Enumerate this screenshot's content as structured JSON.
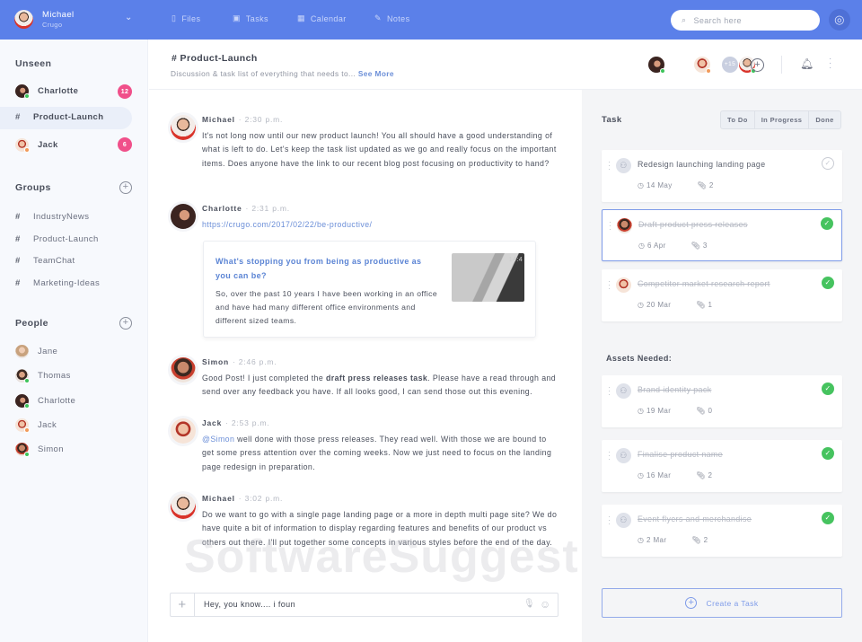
{
  "user": {
    "name": "Michael",
    "org": "Crugo"
  },
  "nav": [
    {
      "label": "Files",
      "icon": "file-icon"
    },
    {
      "label": "Tasks",
      "icon": "tasks-icon"
    },
    {
      "label": "Calendar",
      "icon": "calendar-icon"
    },
    {
      "label": "Notes",
      "icon": "notes-icon"
    }
  ],
  "search": {
    "placeholder": "Search here"
  },
  "sidebar": {
    "unseen_title": "Unseen",
    "unseen": [
      {
        "label": "Charlotte",
        "badge": "12"
      },
      {
        "label": "Product-Launch"
      },
      {
        "label": "Jack",
        "badge": "6"
      }
    ],
    "groups_title": "Groups",
    "groups": [
      "IndustryNews",
      "Product-Launch",
      "TeamChat",
      "Marketing-Ideas"
    ],
    "people_title": "People",
    "people": [
      "Jane",
      "Thomas",
      "Charlotte",
      "Jack",
      "Simon"
    ]
  },
  "channel": {
    "title": "# Product-Launch",
    "desc": "Discussion & task list of everything that needs to...",
    "see_more": "See More",
    "member_extra": "+15"
  },
  "messages": [
    {
      "author": "Michael",
      "time": "2:30 p.m.",
      "text": "It's not long now until our new product launch! You all should have a good understanding of what is left to do. Let's keep the task list updated as we go and really focus on the important items. Does anyone have the link to our recent blog post focusing on productivity to hand?"
    },
    {
      "author": "Charlotte",
      "time": "2:31 p.m.",
      "link": "https://crugo.com/2017/02/22/be-productive/",
      "preview_title": "What's stopping you from being as productive as you can be?",
      "preview_text": "So, over the past 10 years I have been working in an office and have had many different office environments and different sized teams.",
      "preview_img_text": "14:4"
    },
    {
      "author": "Simon",
      "time": "2:46 p.m.",
      "pre": "Good Post! I just completed the ",
      "bold": "draft press releases task",
      "post": ". Please have a read through and send over any feedback you have. If all looks good, I can send those out this evening."
    },
    {
      "author": "Jack",
      "time": "2:53 p.m.",
      "mention": "@Simon",
      "text": " well done with those press releases. They read well. With those we are bound to get some press attention over the coming weeks. Now we just need to focus on the landing page redesign in preparation."
    },
    {
      "author": "Michael",
      "time": "3:02 p.m.",
      "text": "Do we want to go with a single page landing page or a more in depth multi page site? We do have quite a bit of information to display regarding features and benefits of our product vs others out there. I'll put together some concepts in various styles before the end of the day."
    }
  ],
  "composer": {
    "value": "Hey, you know.... i foun"
  },
  "tasks": {
    "title": "Task",
    "filters": [
      "To Do",
      "In Progress",
      "Done"
    ],
    "items": [
      {
        "title": "Redesign launching landing page",
        "date": "14 May",
        "attachments": "2",
        "done": false
      },
      {
        "title": "Draft product press releases",
        "date": "6 Apr",
        "attachments": "3",
        "done": true
      },
      {
        "title": "Competitor market research report",
        "date": "20 Mar",
        "attachments": "1",
        "done": true
      }
    ],
    "assets_title": "Assets Needed:",
    "assets": [
      {
        "title": "Brand identity pack",
        "date": "19 Mar",
        "attachments": "0",
        "done": true
      },
      {
        "title": "Finalise product name",
        "date": "16 Mar",
        "attachments": "2",
        "done": true
      },
      {
        "title": "Event flyers and merchandise",
        "date": "2 Mar",
        "attachments": "2",
        "done": true
      }
    ],
    "create_label": "Create a Task"
  },
  "watermark": "SoftwareSuggest.com",
  "colors": {
    "accent": "#5b80e9",
    "badge": "#f0508a",
    "done": "#46c35f"
  }
}
